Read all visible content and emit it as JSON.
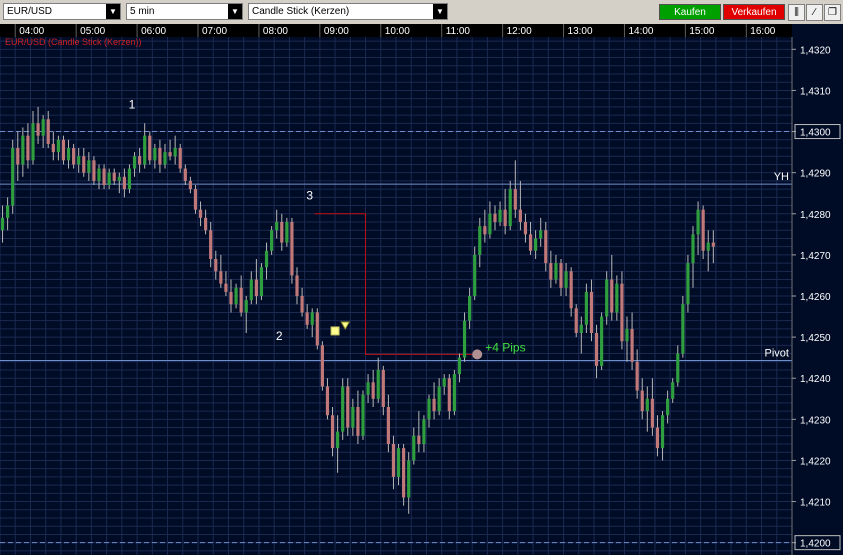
{
  "toolbar": {
    "symbol": "EUR/USD",
    "interval": "5 min",
    "chart_type": "Candle Stick (Kerzen)",
    "buy_label": "Kaufen",
    "sell_label": "Verkaufen",
    "colors": {
      "buy": "#00a000",
      "sell": "#e00000"
    }
  },
  "colors": {
    "background": "#000b26",
    "grid": "#1c2a52",
    "up_candle": "#2e9e3e",
    "down_candle": "#c07878",
    "wick": "#b8b8b8",
    "level_line": "#6f8fd0",
    "trade_line": "#c01010",
    "pips_text": "#40e040",
    "series_label": "#d02020"
  },
  "chart_data": {
    "type": "candlestick",
    "series_label": "EUR/USD (Candle Stick (Kerzen))",
    "x_ticks": [
      "04:00",
      "05:00",
      "06:00",
      "07:00",
      "08:00",
      "09:00",
      "10:00",
      "11:00",
      "12:00",
      "13:00",
      "14:00",
      "15:00",
      "16:00"
    ],
    "y_ticks": [
      "1,4320",
      "1,4310",
      "1,4300",
      "1,4290",
      "1,4280",
      "1,4270",
      "1,4260",
      "1,4250",
      "1,4240",
      "1,4230",
      "1,4220",
      "1,4210",
      "1,4200"
    ],
    "y_tick_values": [
      1.432,
      1.431,
      1.43,
      1.429,
      1.428,
      1.427,
      1.426,
      1.425,
      1.424,
      1.423,
      1.422,
      1.421,
      1.42
    ],
    "ylim": [
      1.4197,
      1.4323
    ],
    "xlim_minutes_from_0345": [
      0,
      780
    ],
    "highlighted_ticks": [
      "1,4300",
      "1,4200"
    ],
    "dashed_levels": [
      1.43,
      1.42
    ],
    "solid_levels": [
      {
        "label": "YH",
        "value": 1.42872
      },
      {
        "label": "Pivot",
        "value": 1.42443
      }
    ],
    "annotations": [
      {
        "text": "1",
        "time": "05:55",
        "price": 1.43056
      },
      {
        "text": "2",
        "time": "08:20",
        "price": 1.42493
      },
      {
        "text": "3",
        "time": "08:50",
        "price": 1.42835
      }
    ],
    "trade": {
      "label": "+4 Pips",
      "entry_time": "08:55",
      "entry_price": 1.428,
      "box_right_time": "09:45",
      "exit_time": "11:35",
      "exit_price": 1.42458
    },
    "markers": [
      {
        "type": "entry-square",
        "time": "09:15",
        "price": 1.42515
      },
      {
        "type": "triangle-down",
        "time": "09:25",
        "price": 1.42527
      }
    ],
    "candles": [
      [
        1.4276,
        1.4282,
        1.4273,
        1.4279
      ],
      [
        1.4279,
        1.4284,
        1.4276,
        1.4282
      ],
      [
        1.4282,
        1.4298,
        1.428,
        1.4296
      ],
      [
        1.4296,
        1.43,
        1.4288,
        1.4292
      ],
      [
        1.4292,
        1.4301,
        1.4289,
        1.4299
      ],
      [
        1.4299,
        1.4302,
        1.4291,
        1.4293
      ],
      [
        1.4293,
        1.4305,
        1.4292,
        1.4302
      ],
      [
        1.4302,
        1.4306,
        1.4297,
        1.4299
      ],
      [
        1.4299,
        1.4304,
        1.4296,
        1.4303
      ],
      [
        1.4303,
        1.4305,
        1.4296,
        1.4297
      ],
      [
        1.4297,
        1.43,
        1.4293,
        1.4295
      ],
      [
        1.4295,
        1.4299,
        1.4293,
        1.4298
      ],
      [
        1.4298,
        1.4299,
        1.4292,
        1.4293
      ],
      [
        1.4293,
        1.4298,
        1.4291,
        1.4296
      ],
      [
        1.4296,
        1.4297,
        1.4291,
        1.4292
      ],
      [
        1.4292,
        1.4296,
        1.429,
        1.4294
      ],
      [
        1.4294,
        1.4296,
        1.4289,
        1.429
      ],
      [
        1.429,
        1.4295,
        1.4288,
        1.4293
      ],
      [
        1.4293,
        1.4294,
        1.4287,
        1.4288
      ],
      [
        1.4288,
        1.4292,
        1.4286,
        1.4291
      ],
      [
        1.4291,
        1.4292,
        1.4286,
        1.4287
      ],
      [
        1.4287,
        1.4291,
        1.4286,
        1.429
      ],
      [
        1.429,
        1.4291,
        1.4287,
        1.4288
      ],
      [
        1.4288,
        1.429,
        1.4285,
        1.4289
      ],
      [
        1.4289,
        1.4291,
        1.4284,
        1.4286
      ],
      [
        1.4286,
        1.4292,
        1.4285,
        1.4291
      ],
      [
        1.4291,
        1.4295,
        1.4289,
        1.4294
      ],
      [
        1.4294,
        1.4296,
        1.429,
        1.4292
      ],
      [
        1.4292,
        1.4302,
        1.4291,
        1.4299
      ],
      [
        1.4299,
        1.43,
        1.4292,
        1.4293
      ],
      [
        1.4293,
        1.4297,
        1.4291,
        1.4296
      ],
      [
        1.4296,
        1.4298,
        1.429,
        1.4292
      ],
      [
        1.4292,
        1.4297,
        1.4291,
        1.4295
      ],
      [
        1.4295,
        1.4298,
        1.4293,
        1.4294
      ],
      [
        1.4294,
        1.4299,
        1.4292,
        1.4296
      ],
      [
        1.4296,
        1.4297,
        1.429,
        1.4291
      ],
      [
        1.4291,
        1.4292,
        1.4287,
        1.4288
      ],
      [
        1.4288,
        1.4289,
        1.4285,
        1.4286
      ],
      [
        1.4286,
        1.4287,
        1.428,
        1.4281
      ],
      [
        1.4281,
        1.4283,
        1.4277,
        1.4279
      ],
      [
        1.4279,
        1.4281,
        1.4275,
        1.4276
      ],
      [
        1.4276,
        1.4278,
        1.4267,
        1.4269
      ],
      [
        1.4269,
        1.4271,
        1.4264,
        1.4266
      ],
      [
        1.4266,
        1.427,
        1.4262,
        1.4263
      ],
      [
        1.4263,
        1.4266,
        1.426,
        1.4261
      ],
      [
        1.4261,
        1.4264,
        1.4256,
        1.4258
      ],
      [
        1.4258,
        1.4263,
        1.4257,
        1.4262
      ],
      [
        1.4262,
        1.4265,
        1.4255,
        1.4256
      ],
      [
        1.4256,
        1.426,
        1.4251,
        1.4259
      ],
      [
        1.4259,
        1.4266,
        1.4258,
        1.4264
      ],
      [
        1.4264,
        1.4269,
        1.4258,
        1.426
      ],
      [
        1.426,
        1.4268,
        1.4259,
        1.4267
      ],
      [
        1.4267,
        1.4273,
        1.4264,
        1.4271
      ],
      [
        1.4271,
        1.4277,
        1.427,
        1.4276
      ],
      [
        1.4276,
        1.4281,
        1.4274,
        1.4278
      ],
      [
        1.4278,
        1.428,
        1.4271,
        1.4273
      ],
      [
        1.4273,
        1.4279,
        1.4272,
        1.4278
      ],
      [
        1.4278,
        1.4279,
        1.4263,
        1.4265
      ],
      [
        1.4265,
        1.4267,
        1.4258,
        1.426
      ],
      [
        1.426,
        1.4262,
        1.4255,
        1.4256
      ],
      [
        1.4256,
        1.4258,
        1.4252,
        1.4253
      ],
      [
        1.4253,
        1.4257,
        1.425,
        1.4256
      ],
      [
        1.4256,
        1.4257,
        1.4247,
        1.4248
      ],
      [
        1.4248,
        1.4249,
        1.4237,
        1.4238
      ],
      [
        1.4238,
        1.424,
        1.423,
        1.4231
      ],
      [
        1.4231,
        1.4233,
        1.4221,
        1.4223
      ],
      [
        1.4223,
        1.4231,
        1.4217,
        1.4227
      ],
      [
        1.4227,
        1.424,
        1.4225,
        1.4238
      ],
      [
        1.4238,
        1.424,
        1.4226,
        1.4228
      ],
      [
        1.4228,
        1.4235,
        1.4226,
        1.4233
      ],
      [
        1.4233,
        1.4237,
        1.4224,
        1.4226
      ],
      [
        1.4226,
        1.4237,
        1.4225,
        1.4236
      ],
      [
        1.4236,
        1.4241,
        1.4234,
        1.4239
      ],
      [
        1.4239,
        1.4242,
        1.4233,
        1.4235
      ],
      [
        1.4235,
        1.4245,
        1.4234,
        1.4242
      ],
      [
        1.4242,
        1.4243,
        1.4231,
        1.4233
      ],
      [
        1.4233,
        1.4236,
        1.4222,
        1.4224
      ],
      [
        1.4224,
        1.4226,
        1.4213,
        1.4216
      ],
      [
        1.4216,
        1.4224,
        1.4214,
        1.4223
      ],
      [
        1.4223,
        1.4224,
        1.4209,
        1.4211
      ],
      [
        1.4211,
        1.4222,
        1.4207,
        1.422
      ],
      [
        1.422,
        1.4228,
        1.4219,
        1.4226
      ],
      [
        1.4226,
        1.4232,
        1.4222,
        1.4224
      ],
      [
        1.4224,
        1.4231,
        1.4222,
        1.423
      ],
      [
        1.423,
        1.4236,
        1.4228,
        1.4235
      ],
      [
        1.4235,
        1.4239,
        1.423,
        1.4232
      ],
      [
        1.4232,
        1.424,
        1.4231,
        1.4238
      ],
      [
        1.4238,
        1.4241,
        1.4236,
        1.424
      ],
      [
        1.424,
        1.4241,
        1.423,
        1.4232
      ],
      [
        1.4232,
        1.4242,
        1.4231,
        1.4241
      ],
      [
        1.4241,
        1.4246,
        1.4239,
        1.4245
      ],
      [
        1.4245,
        1.4256,
        1.4244,
        1.4254
      ],
      [
        1.4254,
        1.4262,
        1.4252,
        1.426
      ],
      [
        1.426,
        1.4272,
        1.4259,
        1.427
      ],
      [
        1.427,
        1.4279,
        1.4267,
        1.4277
      ],
      [
        1.4277,
        1.4281,
        1.4273,
        1.4275
      ],
      [
        1.4275,
        1.4283,
        1.4274,
        1.428
      ],
      [
        1.428,
        1.4282,
        1.4276,
        1.4278
      ],
      [
        1.4278,
        1.4283,
        1.4277,
        1.4281
      ],
      [
        1.4281,
        1.4286,
        1.4275,
        1.4277
      ],
      [
        1.4277,
        1.4288,
        1.4276,
        1.4286
      ],
      [
        1.4286,
        1.4293,
        1.4279,
        1.4281
      ],
      [
        1.4281,
        1.4288,
        1.4276,
        1.4278
      ],
      [
        1.4278,
        1.428,
        1.4273,
        1.4275
      ],
      [
        1.4275,
        1.4278,
        1.427,
        1.4271
      ],
      [
        1.4271,
        1.4276,
        1.4269,
        1.4274
      ],
      [
        1.4274,
        1.4279,
        1.4272,
        1.4276
      ],
      [
        1.4276,
        1.4278,
        1.4266,
        1.4268
      ],
      [
        1.4268,
        1.4271,
        1.4262,
        1.4264
      ],
      [
        1.4264,
        1.427,
        1.4263,
        1.4268
      ],
      [
        1.4268,
        1.4269,
        1.426,
        1.4262
      ],
      [
        1.4262,
        1.4268,
        1.426,
        1.4266
      ],
      [
        1.4266,
        1.4267,
        1.4255,
        1.4257
      ],
      [
        1.4257,
        1.4258,
        1.425,
        1.4251
      ],
      [
        1.4251,
        1.4255,
        1.4246,
        1.4253
      ],
      [
        1.4253,
        1.4263,
        1.4251,
        1.4261
      ],
      [
        1.4261,
        1.4264,
        1.4249,
        1.4251
      ],
      [
        1.4251,
        1.4253,
        1.424,
        1.4243
      ],
      [
        1.4243,
        1.4256,
        1.4242,
        1.4255
      ],
      [
        1.4255,
        1.4266,
        1.4253,
        1.4264
      ],
      [
        1.4264,
        1.427,
        1.4254,
        1.4256
      ],
      [
        1.4256,
        1.4265,
        1.4254,
        1.4263
      ],
      [
        1.4263,
        1.4266,
        1.4247,
        1.4249
      ],
      [
        1.4249,
        1.4255,
        1.4244,
        1.4252
      ],
      [
        1.4252,
        1.4256,
        1.4242,
        1.4244
      ],
      [
        1.4244,
        1.4247,
        1.4235,
        1.4237
      ],
      [
        1.4237,
        1.424,
        1.423,
        1.4232
      ],
      [
        1.4232,
        1.4238,
        1.4227,
        1.4235
      ],
      [
        1.4235,
        1.424,
        1.4226,
        1.4228
      ],
      [
        1.4228,
        1.4231,
        1.4221,
        1.4223
      ],
      [
        1.4223,
        1.4232,
        1.422,
        1.4231
      ],
      [
        1.4231,
        1.4237,
        1.4229,
        1.4235
      ],
      [
        1.4235,
        1.424,
        1.4234,
        1.4239
      ],
      [
        1.4239,
        1.4248,
        1.4238,
        1.4246
      ],
      [
        1.4246,
        1.426,
        1.4245,
        1.4258
      ],
      [
        1.4258,
        1.427,
        1.4256,
        1.4268
      ],
      [
        1.4268,
        1.4277,
        1.4262,
        1.4275
      ],
      [
        1.4275,
        1.4283,
        1.427,
        1.4281
      ],
      [
        1.4281,
        1.4282,
        1.4269,
        1.4271
      ],
      [
        1.4271,
        1.4276,
        1.4266,
        1.4273
      ],
      [
        1.4273,
        1.4276,
        1.4268,
        1.4272
      ]
    ]
  }
}
